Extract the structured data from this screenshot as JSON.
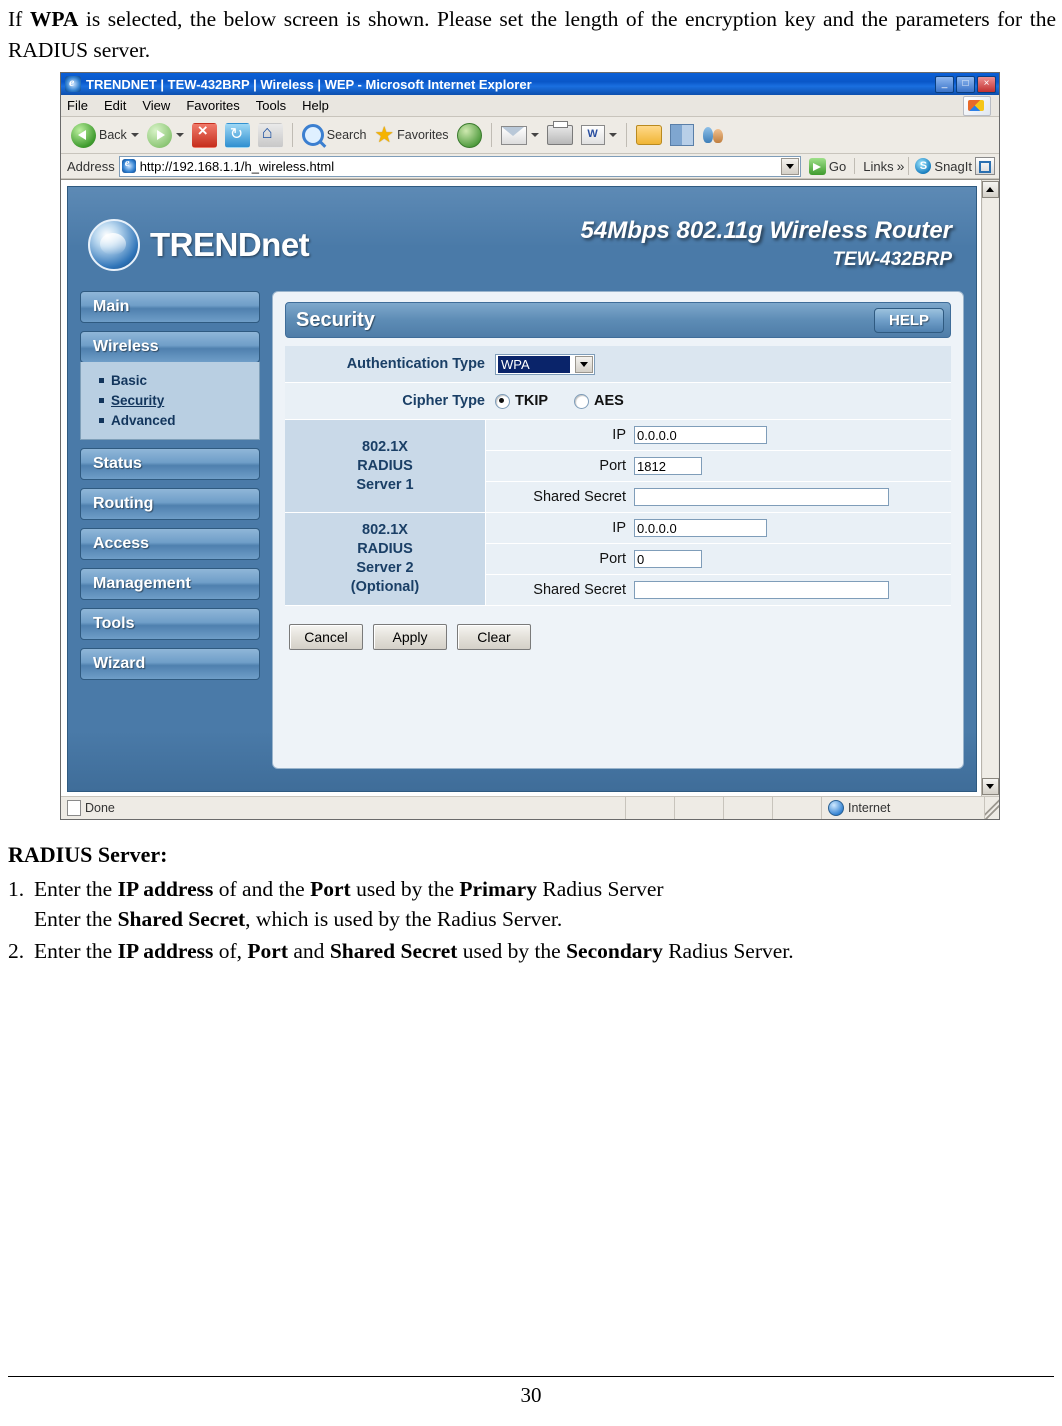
{
  "intro": {
    "text_before_bold": "If ",
    "bold1": "WPA",
    "text_after": " is selected, the below screen is shown.  Please set the length of the encryption key and the parameters for the RADIUS server."
  },
  "browser": {
    "title": "TRENDNET | TEW-432BRP | Wireless | WEP - Microsoft Internet Explorer",
    "window_buttons": [
      "_",
      "□",
      "×"
    ],
    "menus": [
      "File",
      "Edit",
      "View",
      "Favorites",
      "Tools",
      "Help"
    ],
    "toolbar": {
      "back": "Back",
      "forward": "",
      "stop": "",
      "refresh": "",
      "home": "",
      "search": "Search",
      "favorites": "Favorites",
      "media": "",
      "mail": "",
      "print": "",
      "edit": "W",
      "folder": "",
      "discuss": "",
      "messenger": ""
    },
    "address": {
      "label": "Address",
      "url": "http://192.168.1.1/h_wireless.html",
      "go": "Go",
      "links": "Links",
      "chevron": "»",
      "snagit": "SnagIt"
    },
    "status": {
      "text": "Done",
      "zone": "Internet"
    }
  },
  "router": {
    "brand": "TRENDnet",
    "model_title": "54Mbps 802.11g Wireless Router",
    "model_sub": "TEW-432BRP",
    "nav": [
      {
        "label": "Main",
        "type": "button"
      },
      {
        "label": "Wireless",
        "type": "button"
      },
      {
        "label": "Status",
        "type": "button"
      },
      {
        "label": "Routing",
        "type": "button"
      },
      {
        "label": "Access",
        "type": "button"
      },
      {
        "label": "Management",
        "type": "button"
      },
      {
        "label": "Tools",
        "type": "button"
      },
      {
        "label": "Wizard",
        "type": "button"
      }
    ],
    "nav_sub": [
      {
        "label": "Basic",
        "active": false
      },
      {
        "label": "Security",
        "active": true
      },
      {
        "label": "Advanced",
        "active": false
      }
    ],
    "panel": {
      "title": "Security",
      "help": "HELP",
      "auth_label": "Authentication Type",
      "auth_value": "WPA",
      "cipher_label": "Cipher Type",
      "cipher_options": [
        {
          "label": "TKIP",
          "checked": true
        },
        {
          "label": "AES",
          "checked": false
        }
      ],
      "server1": {
        "title_lines": [
          "802.1X",
          "RADIUS",
          "Server 1"
        ],
        "ip_label": "IP",
        "ip_value": "0.0.0.0",
        "port_label": "Port",
        "port_value": "1812",
        "secret_label": "Shared Secret",
        "secret_value": ""
      },
      "server2": {
        "title_lines": [
          "802.1X",
          "RADIUS",
          "Server 2",
          "(Optional)"
        ],
        "ip_label": "IP",
        "ip_value": "0.0.0.0",
        "port_label": "Port",
        "port_value": "0",
        "secret_label": "Shared Secret",
        "secret_value": ""
      },
      "buttons": [
        "Cancel",
        "Apply",
        "Clear"
      ]
    }
  },
  "radius_section": {
    "heading": "RADIUS Server:",
    "items": [
      {
        "num": "1.",
        "line1_parts": [
          "Enter the ",
          "IP address",
          " of and the ",
          "Port",
          " used by the ",
          "Primary",
          " Radius Server"
        ],
        "line2_parts": [
          "Enter the ",
          "Shared Secret",
          ", which is used by the Radius Server."
        ]
      },
      {
        "num": "2.",
        "line1_parts": [
          "Enter the ",
          "IP address",
          " of, ",
          "Port",
          " and ",
          "Shared Secret",
          " used by the ",
          "Secondary",
          " Radius Server."
        ]
      }
    ]
  },
  "footer": {
    "page_number": "30"
  }
}
